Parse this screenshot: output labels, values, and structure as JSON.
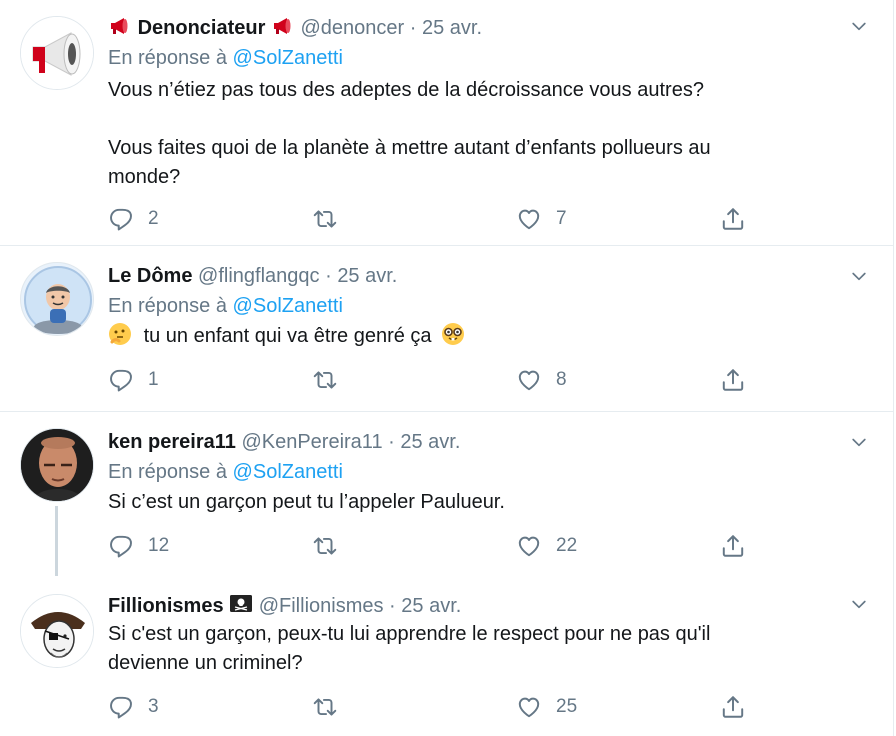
{
  "tweets": [
    {
      "name": "Denonciateur",
      "name_prefix_icon": "megaphone-emoji",
      "name_suffix_icon": "megaphone-emoji",
      "handle": "@denoncer",
      "dot": "·",
      "time": "25 avr.",
      "reply_prefix": "En réponse à",
      "reply_to": "@SolZanetti",
      "text_line1": "Vous n’étiez pas tous des adeptes de la décroissance vous autres?",
      "text_line2": "Vous faites quoi de la planète à mettre autant d’enfants pollueurs au",
      "text_line3": "monde?",
      "replies": "2",
      "retweets": "",
      "likes": "7"
    },
    {
      "name": "Le Dôme",
      "handle": "@flingflangqc",
      "dot": "·",
      "time": "25 avr.",
      "reply_prefix": "En réponse à",
      "reply_to": "@SolZanetti",
      "text": "tu un enfant qui va être genré ça",
      "text_prefix_icon": "thinking-face-emoji",
      "text_suffix_icon": "nerd-face-emoji",
      "replies": "1",
      "retweets": "",
      "likes": "8"
    },
    {
      "name": "ken pereira11",
      "handle": "@KenPereira11",
      "dot": "·",
      "time": "25 avr.",
      "reply_prefix": "En réponse à",
      "reply_to": "@SolZanetti",
      "text": "Si c’est un garçon peut tu l’appeler Paulueur.",
      "replies": "12",
      "retweets": "",
      "likes": "22"
    },
    {
      "name": "Fillionismes",
      "name_suffix_icon": "pirate-flag-emoji",
      "handle": "@Fillionismes",
      "dot": "·",
      "time": "25 avr.",
      "text_line1": "Si c'est un garçon, peux-tu lui apprendre le respect pour ne pas qu'il",
      "text_line2": "devienne un criminel?",
      "replies": "3",
      "retweets": "",
      "likes": "25"
    }
  ],
  "colors": {
    "text": "#14171a",
    "muted": "#657786",
    "link": "#1da1f2",
    "divider": "#e6ecf0",
    "thread_line": "#ccd6dd"
  }
}
